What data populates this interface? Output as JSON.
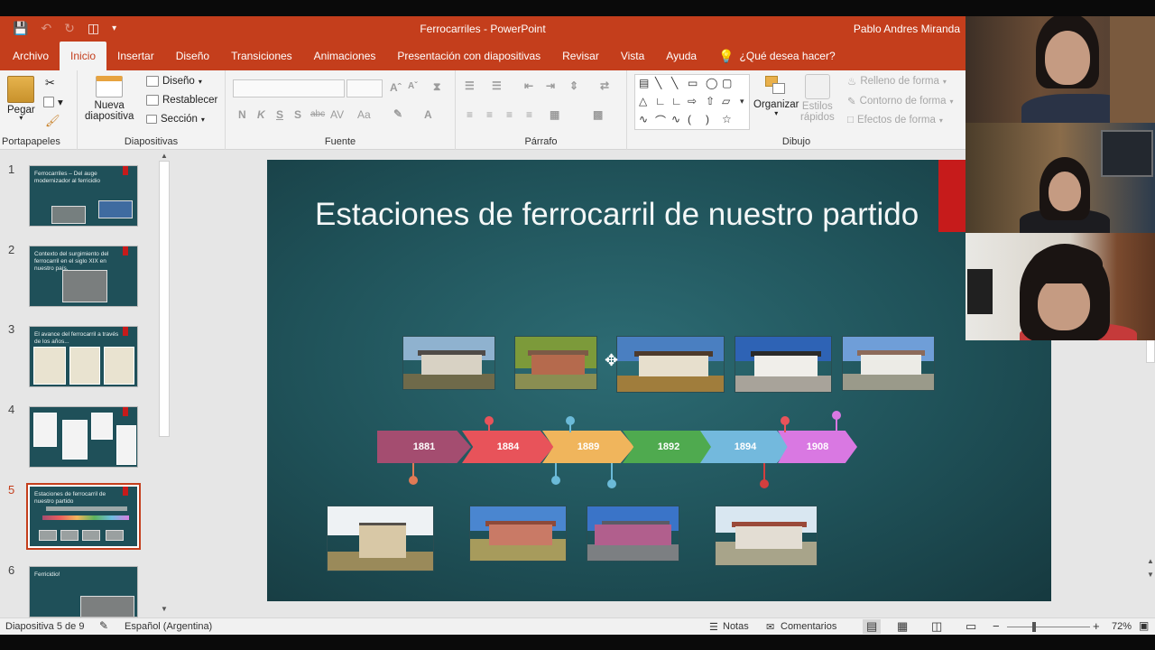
{
  "window": {
    "title": "Ferrocarriles  -  PowerPoint",
    "user": "Pablo Andres Miranda"
  },
  "tabs": [
    {
      "label": "Archivo"
    },
    {
      "label": "Inicio"
    },
    {
      "label": "Insertar"
    },
    {
      "label": "Diseño"
    },
    {
      "label": "Transiciones"
    },
    {
      "label": "Animaciones"
    },
    {
      "label": "Presentación con diapositivas"
    },
    {
      "label": "Revisar"
    },
    {
      "label": "Vista"
    },
    {
      "label": "Ayuda"
    }
  ],
  "tell_me": "¿Qué desea hacer?",
  "ribbon": {
    "clipboard": {
      "paste": "Pegar",
      "label": "Portapapeles"
    },
    "slides": {
      "new_slide_1": "Nueva",
      "new_slide_2": "diapositiva",
      "layout": "Diseño",
      "reset": "Restablecer",
      "section": "Sección",
      "label": "Diapositivas"
    },
    "font": {
      "label": "Fuente",
      "bold": "N",
      "italic": "K",
      "underline": "S",
      "strike": "S",
      "strike2": "abc",
      "spacing": "AV",
      "case": "Aa"
    },
    "paragraph": {
      "label": "Párrafo"
    },
    "drawing": {
      "arrange": "Organizar",
      "styles_1": "Estilos",
      "styles_2": "rápidos",
      "fill": "Relleno de forma",
      "outline": "Contorno de forma",
      "effects": "Efectos de forma",
      "label": "Dibujo"
    }
  },
  "thumbnails": [
    {
      "num": "1",
      "text": "Ferrocarriles – Del auge modernizador al ferricidio"
    },
    {
      "num": "2",
      "text": "Contexto del surgimiento del ferrocarril en el siglo XIX en nuestro país."
    },
    {
      "num": "3",
      "text": "El avance del ferrocarril a través de los años..."
    },
    {
      "num": "4",
      "text": ""
    },
    {
      "num": "5",
      "text": "Estaciones de ferrocarril de nuestro partido"
    },
    {
      "num": "6",
      "text": "Ferricidio!"
    }
  ],
  "slide": {
    "title": "Estaciones de ferrocarril de nuestro partido",
    "timeline": [
      "1881",
      "1884",
      "1889",
      "1892",
      "1894",
      "1908"
    ]
  },
  "status": {
    "slide_of": "Diapositiva 5 de 9",
    "language": "Español (Argentina)",
    "notes": "Notas",
    "comments": "Comentarios",
    "zoom": "72%"
  }
}
